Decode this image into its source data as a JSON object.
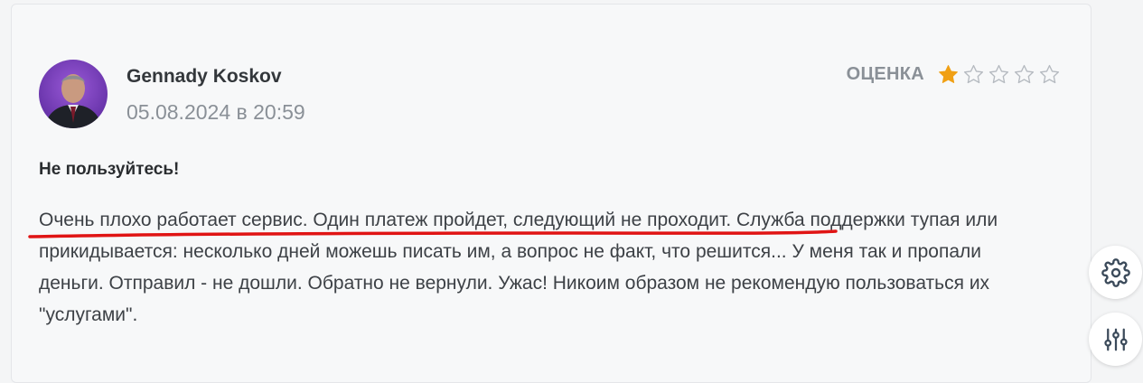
{
  "review": {
    "author": "Gennady Koskov",
    "date": "05.08.2024 в 20:59",
    "rating_label": "ОЦЕНКА",
    "rating_value": 1,
    "rating_max": 5,
    "title": "Не пользуйтесь!",
    "text": "Очень плохо работает сервис. Один платеж пройдет, следующий не проходит. Служба поддержки тупая или прикидывается: несколько дней можешь писать им, а вопрос не факт, что решится... У меня так и пропали деньги. Отправил - не дошли. Обратно не вернули. Ужас! Никоим образом не рекомендую пользоваться их \"услугами\"."
  },
  "colors": {
    "star_filled": "#f0a015",
    "star_empty": "#b5bac0",
    "annotation": "#e01414"
  },
  "icons": {
    "settings": "gear-icon",
    "filters": "sliders-icon"
  }
}
